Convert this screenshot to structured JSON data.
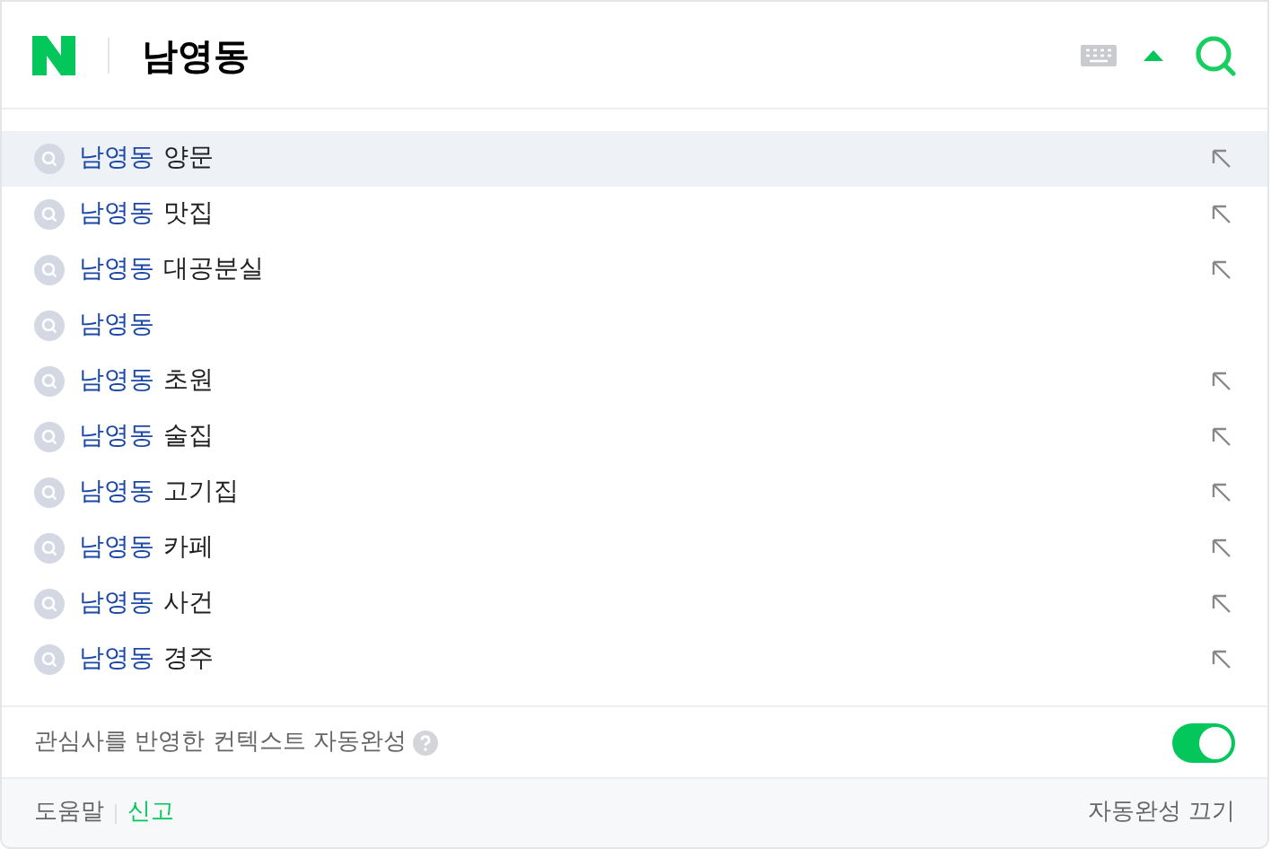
{
  "search": {
    "value": "남영동"
  },
  "suggestions": [
    {
      "match": "남영동",
      "rest": "양문",
      "selected": true,
      "has_arrow": true
    },
    {
      "match": "남영동",
      "rest": "맛집",
      "selected": false,
      "has_arrow": true
    },
    {
      "match": "남영동",
      "rest": "대공분실",
      "selected": false,
      "has_arrow": true
    },
    {
      "match": "남영동",
      "selected": false,
      "has_arrow": false
    },
    {
      "match": "남영동",
      "rest": "초원",
      "selected": false,
      "has_arrow": true
    },
    {
      "match": "남영동",
      "rest": "술집",
      "selected": false,
      "has_arrow": true
    },
    {
      "match": "남영동",
      "rest": "고기집",
      "selected": false,
      "has_arrow": true
    },
    {
      "match": "남영동",
      "rest": "카페",
      "selected": false,
      "has_arrow": true
    },
    {
      "match": "남영동",
      "rest": "사건",
      "selected": false,
      "has_arrow": true
    },
    {
      "match": "남영동",
      "rest": "경주",
      "selected": false,
      "has_arrow": true
    }
  ],
  "context_option": {
    "label": "관심사를 반영한 컨텍스트 자동완성",
    "on": true
  },
  "footer": {
    "links": [
      "도움말",
      "신고"
    ],
    "turn_off": "자동완성 끄기"
  }
}
